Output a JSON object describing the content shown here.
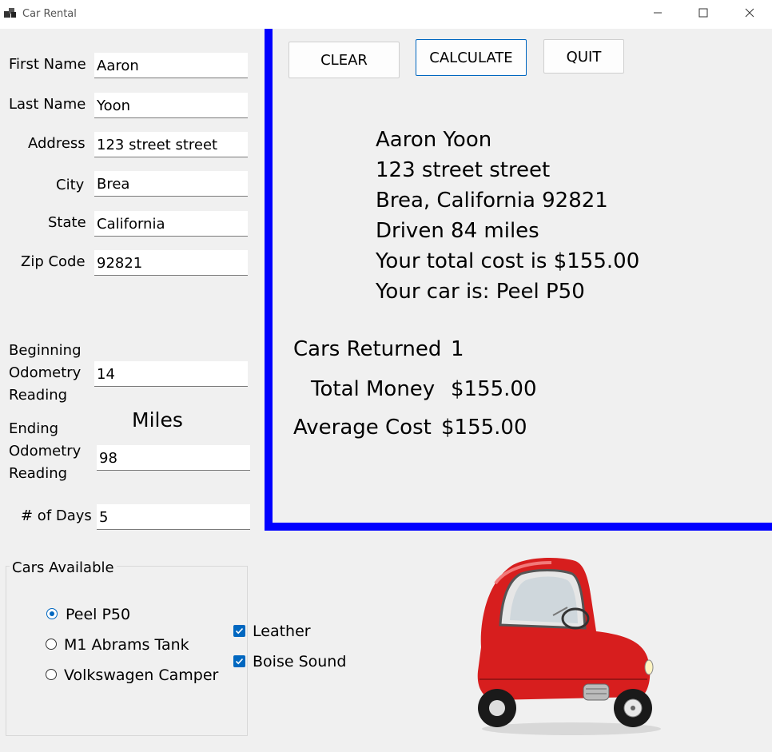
{
  "window": {
    "title": "Car Rental",
    "minimize": "—",
    "maximize": "☐",
    "close": "✕"
  },
  "form": {
    "first_name_label": "First Name",
    "first_name_value": "Aaron",
    "last_name_label": "Last Name",
    "last_name_value": "Yoon",
    "address_label": "Address",
    "address_value": "123 street street",
    "city_label": "City",
    "city_value": "Brea",
    "state_label": "State",
    "state_value": "California",
    "zip_label": "Zip Code",
    "zip_value": "92821",
    "begin_odo_label_1": "Beginning",
    "begin_odo_label_2": "Odometry",
    "begin_odo_label_3": "Reading",
    "begin_odo_value": "14",
    "miles_label": "Miles",
    "end_odo_label_1": "Ending",
    "end_odo_label_2": "Odometry",
    "end_odo_label_3": "Reading",
    "end_odo_value": "98",
    "days_label": "# of Days",
    "days_value": "5"
  },
  "buttons": {
    "clear": "CLEAR",
    "calculate": "CALCULATE",
    "quit": "QUIT"
  },
  "output": {
    "lines": [
      "Aaron Yoon",
      "123 street street",
      "Brea, California 92821",
      "Driven 84 miles",
      "Your total cost is $155.00",
      "Your car is: Peel P50"
    ],
    "cars_returned_label": "Cars Returned",
    "cars_returned_value": "1",
    "total_money_label": "Total Money",
    "total_money_value": "$155.00",
    "average_cost_label": "Average Cost",
    "average_cost_value": "$155.00"
  },
  "cars": {
    "group_title": "Cars Available",
    "options": [
      {
        "label": "Peel P50",
        "selected": true
      },
      {
        "label": "M1 Abrams Tank",
        "selected": false
      },
      {
        "label": "Volkswagen Camper",
        "selected": false
      }
    ]
  },
  "extras": [
    {
      "label": "Leather",
      "checked": true
    },
    {
      "label": "Boise Sound",
      "checked": true
    }
  ],
  "colors": {
    "panel_border": "#0000ff",
    "accent": "#0067c0",
    "car_body": "#d71e1e"
  },
  "icons": {
    "app": "app-icon",
    "check": "checkmark-icon",
    "car_image": "peel-p50-car-image"
  }
}
